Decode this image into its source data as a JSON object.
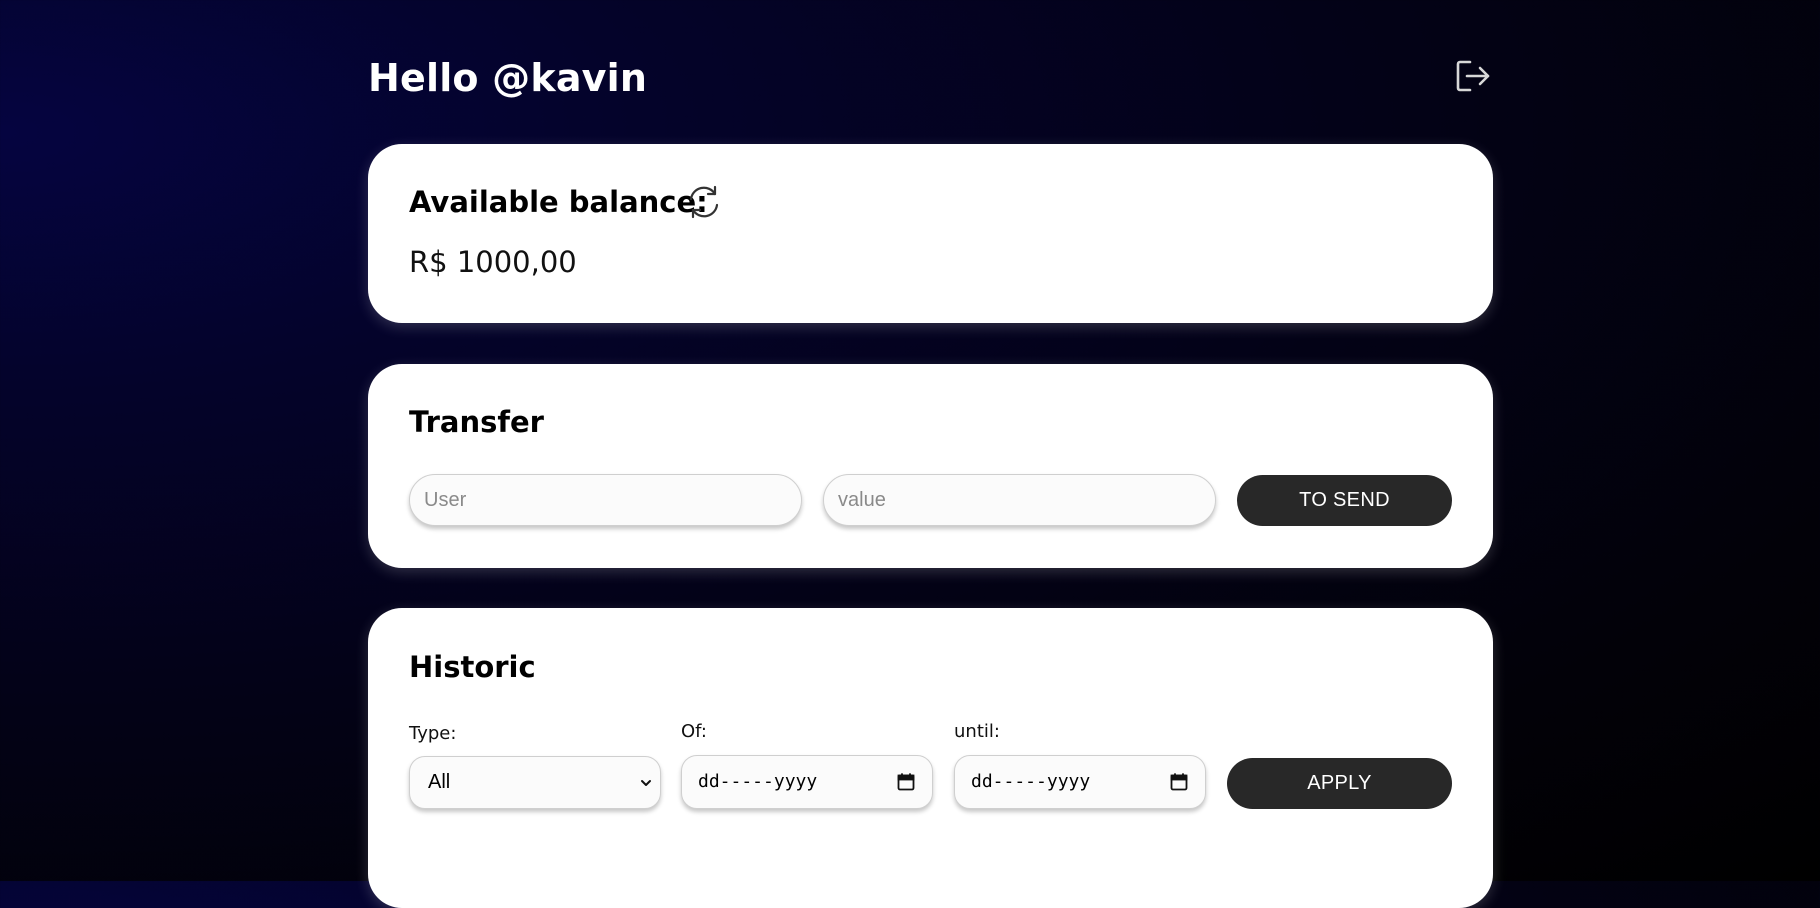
{
  "header": {
    "greeting": "Hello @kavin",
    "logout_icon": "logout-icon"
  },
  "balance": {
    "title": "Available balance:",
    "value": "R$ 1000,00",
    "refresh_icon": "refresh-icon"
  },
  "transfer": {
    "title": "Transfer",
    "user_placeholder": "User",
    "value_placeholder": "value",
    "send_label": "TO SEND"
  },
  "historic": {
    "title": "Historic",
    "type_label": "Type:",
    "type_selected": "All",
    "of_label": "Of:",
    "until_label": "until:",
    "date_of_value": "dd-----yyyy",
    "date_until_value": "dd-----yyyy",
    "apply_label": "APPLY"
  },
  "colors": {
    "background": "#02011a",
    "card": "#ffffff",
    "button": "#282828",
    "button_text": "#ffffff"
  }
}
